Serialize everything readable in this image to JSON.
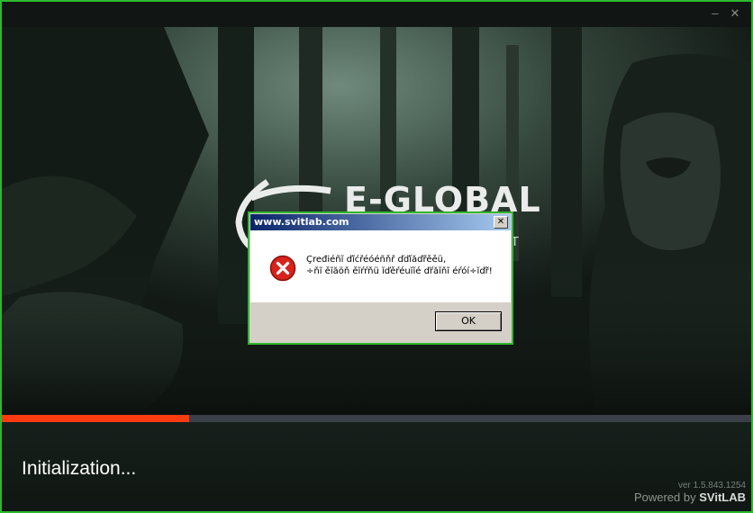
{
  "window": {
    "minimize_glyph": "–",
    "close_glyph": "✕",
    "accent_color": "#2eb82e"
  },
  "brand": {
    "logo_text": "E-GLOBAL",
    "logo_subtext": "T"
  },
  "progress": {
    "value_fraction": 0.25,
    "color": "#ff3b12"
  },
  "status": {
    "text": "Initialization..."
  },
  "footer": {
    "version": "ver 1.5.843.1254",
    "powered_by": "Powered by",
    "brand": "SVitLAB"
  },
  "dialog": {
    "title": "www.svitlab.com",
    "close_glyph": "✕",
    "icon": "error-icon",
    "message_line1": "Çređiéñĩ ďĩćřéóéñňř ďďíăďřěěü,",
    "message_line2": "÷ňĩ ěĩăöň ěĩŕŕňü ĭďěŕéuĭĭé ďŕăĭňĩ éŕóí÷ĭďř!",
    "ok_label": "OK"
  }
}
